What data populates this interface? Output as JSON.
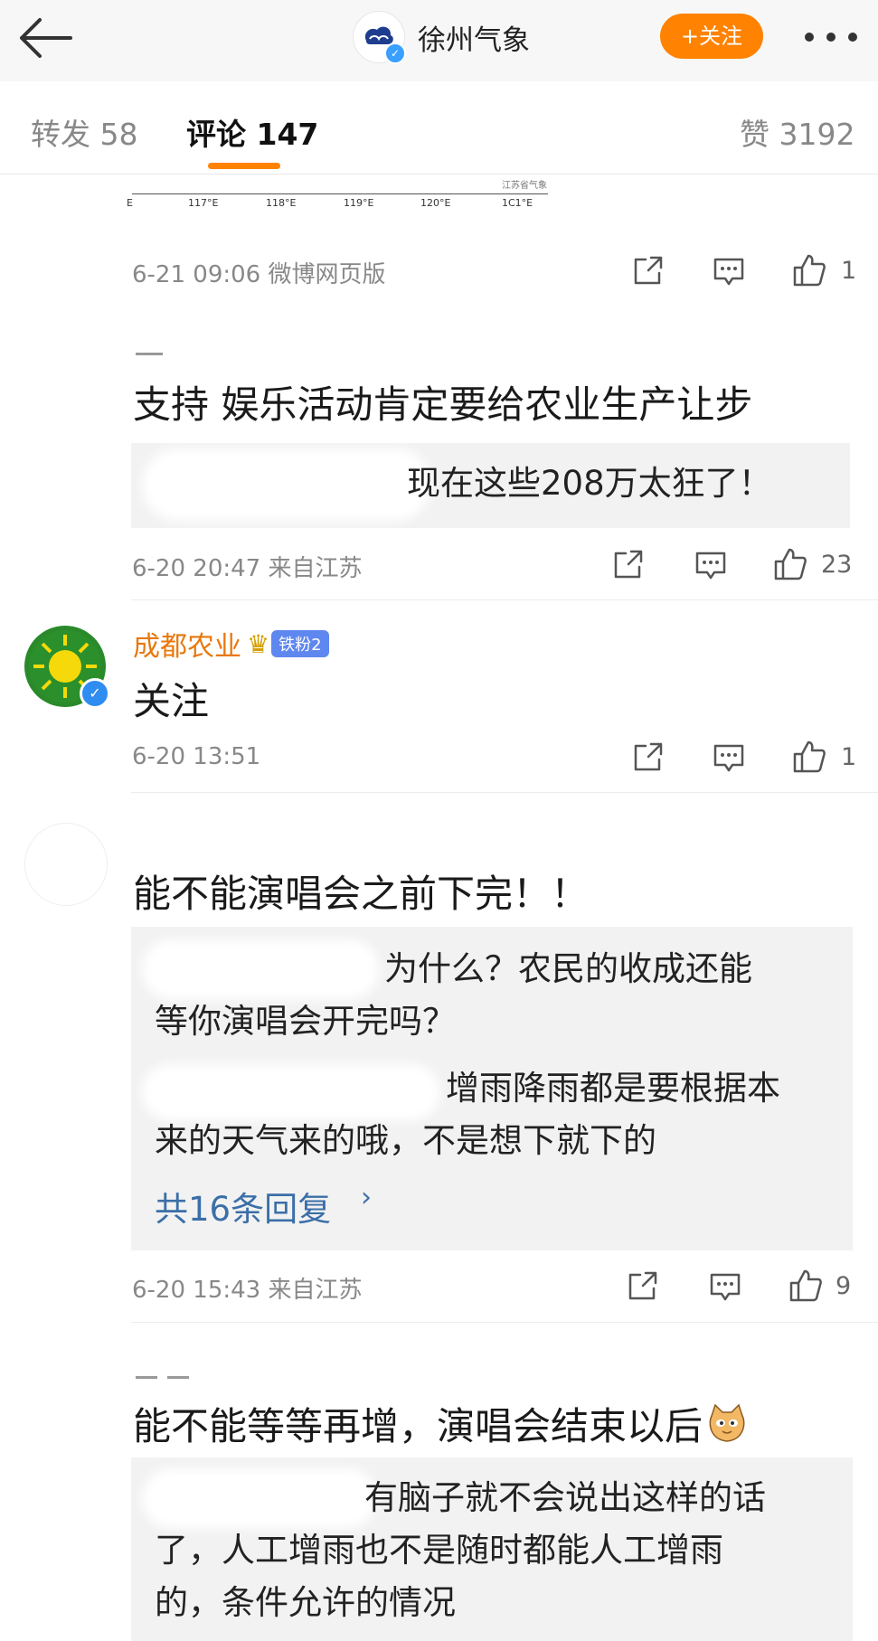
{
  "header": {
    "account_name": "徐州气象",
    "follow_label": "+关注"
  },
  "tabs": [
    {
      "label": "转发 58"
    },
    {
      "label": "评论 147"
    },
    {
      "label": "赞 3192"
    }
  ],
  "map_strip": {
    "ticks": [
      "E",
      "117°E",
      "118°E",
      "119°E",
      "120°E",
      "1C1°E"
    ],
    "corner_text": "江苏省气象"
  },
  "comments": [
    {
      "meta": "6-21 09:06  微博网页版",
      "likes": "1"
    },
    {
      "text": "支持 娱乐活动肯定要给农业生产让步",
      "reply": "现在这些208万太狂了！",
      "meta": "6-20 20:47  来自江苏",
      "likes": "23"
    },
    {
      "user": "成都农业",
      "fan_badge": "铁粉2",
      "text": "关注",
      "meta": "6-20 13:51",
      "likes": "1"
    },
    {
      "text": "能不能演唱会之前下完！！",
      "replies": [
        {
          "line1": "为什么？农民的收成还能",
          "line2": "等你演唱会开完吗？"
        },
        {
          "line1": "增雨降雨都是要根据本",
          "line2": "来的天气来的哦，不是想下就下的"
        }
      ],
      "more_replies": "共16条回复",
      "meta": "6-20 15:43  来自江苏",
      "likes": "9"
    },
    {
      "text": "能不能等等再增，演唱会结束以后",
      "reply": {
        "line1": "有脑子就不会说出这样的话",
        "line2": "了，人工增雨也不是随时都能人工增雨",
        "line3": "的，条件允许的情况"
      }
    }
  ],
  "colors": {
    "accent": "#ff8200",
    "link": "#3b6fa8",
    "username": "#e8780c"
  }
}
